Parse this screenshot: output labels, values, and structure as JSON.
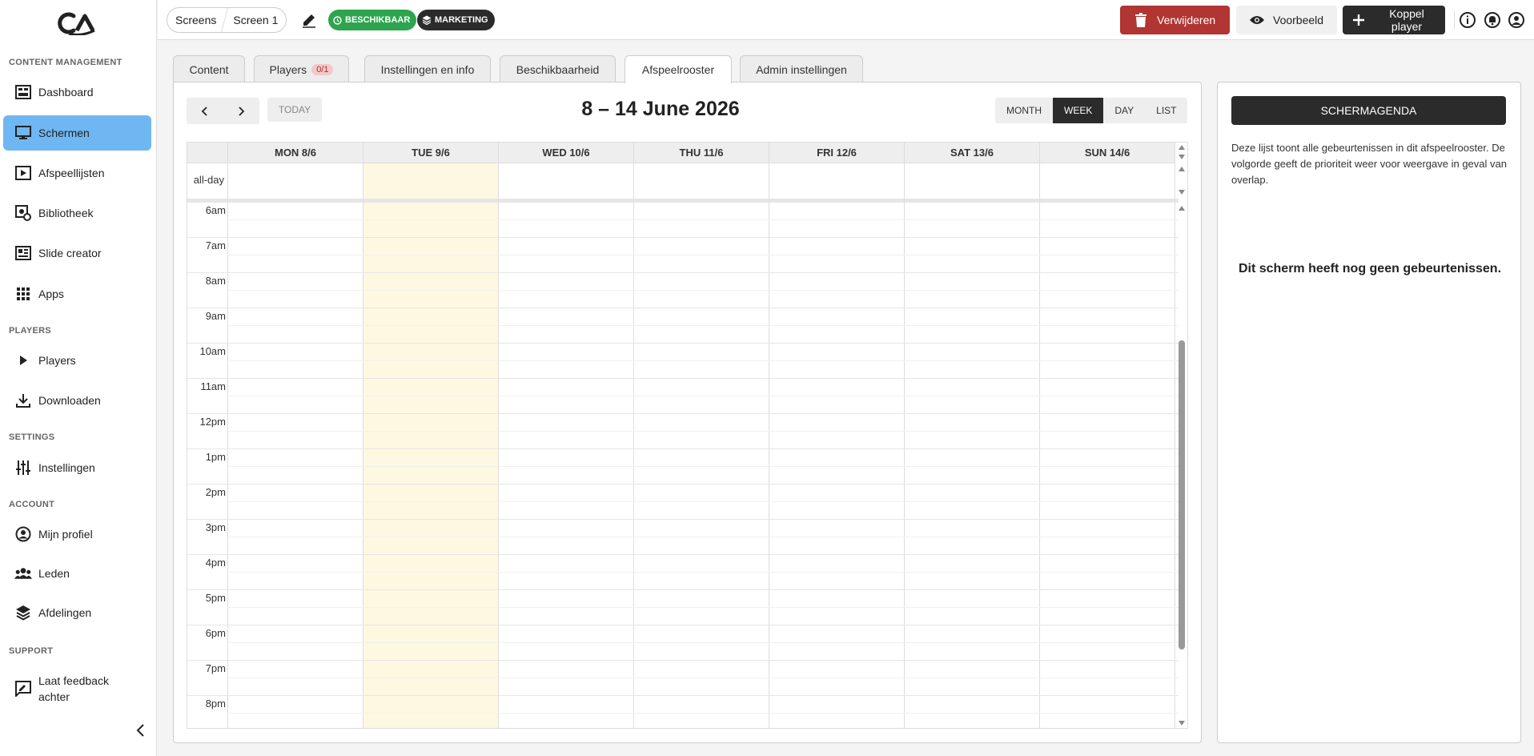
{
  "sidebar": {
    "sections": [
      {
        "title": "CONTENT MANAGEMENT"
      },
      {
        "title": "PLAYERS"
      },
      {
        "title": "SETTINGS"
      },
      {
        "title": "ACCOUNT"
      },
      {
        "title": "SUPPORT"
      }
    ],
    "items": [
      {
        "label": "Dashboard",
        "icon": "dashboard-icon"
      },
      {
        "label": "Schermen",
        "icon": "monitor-icon",
        "active": true
      },
      {
        "label": "Afspeellijsten",
        "icon": "playlist-icon"
      },
      {
        "label": "Bibliotheek",
        "icon": "library-icon"
      },
      {
        "label": "Slide creator",
        "icon": "slide-creator-icon"
      },
      {
        "label": "Apps",
        "icon": "apps-grid-icon"
      },
      {
        "label": "Players",
        "icon": "play-icon"
      },
      {
        "label": "Downloaden",
        "icon": "download-icon"
      },
      {
        "label": "Instellingen",
        "icon": "sliders-icon"
      },
      {
        "label": "Mijn profiel",
        "icon": "profile-icon"
      },
      {
        "label": "Leden",
        "icon": "members-icon"
      },
      {
        "label": "Afdelingen",
        "icon": "layers-icon"
      },
      {
        "label": "Laat feedback achter",
        "line1": "Laat feedback",
        "line2": "achter",
        "icon": "feedback-icon"
      }
    ]
  },
  "topbar": {
    "breadcrumbs": [
      "Screens",
      "Screen 1"
    ],
    "badges": [
      {
        "label": "BESCHIKBAAR",
        "color": "#2ea44f"
      },
      {
        "label": "MARKETING",
        "color": "#2b2b2b"
      }
    ],
    "delete_label": "Verwijderen",
    "preview_label": "Voorbeeld",
    "link_player_line1": "Koppel",
    "link_player_line2": "player"
  },
  "tabs": [
    {
      "label": "Content"
    },
    {
      "label": "Players",
      "count": "0/1"
    },
    {
      "label": "Instellingen en info"
    },
    {
      "label": "Beschikbaarheid"
    },
    {
      "label": "Afspeelrooster",
      "active": true
    },
    {
      "label": "Admin instellingen"
    }
  ],
  "calendar": {
    "title": "8 – 14 June 2026",
    "today_label": "TODAY",
    "views": [
      "MONTH",
      "WEEK",
      "DAY",
      "LIST"
    ],
    "active_view": "WEEK",
    "days": [
      "MON 8/6",
      "TUE 9/6",
      "WED 10/6",
      "THU 11/6",
      "FRI 12/6",
      "SAT 13/6",
      "SUN 14/6"
    ],
    "today_index": 1,
    "allday_label": "all-day",
    "hours": [
      "6am",
      "7am",
      "8am",
      "9am",
      "10am",
      "11am",
      "12pm",
      "1pm",
      "2pm",
      "3pm",
      "4pm",
      "5pm",
      "6pm",
      "7pm",
      "8pm"
    ],
    "highlight_color": "#fdf8e1"
  },
  "agenda": {
    "button_label": "SCHERMAGENDA",
    "description": "Deze lijst toont alle gebeurtenissen in dit afspeelrooster. De volgorde geeft de prioriteit weer voor weergave in geval van overlap.",
    "empty_message": "Dit scherm heeft nog geen gebeurtenissen."
  }
}
